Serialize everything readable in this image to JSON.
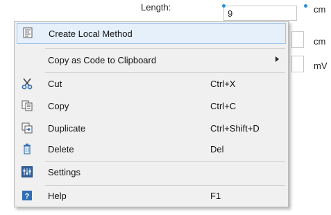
{
  "form": {
    "length_label": "Length:",
    "length_value": "9",
    "units": [
      "cm",
      "cm",
      "mV"
    ]
  },
  "menu": {
    "create_local_method": "Create Local Method",
    "copy_as_code": "Copy as Code to Clipboard",
    "cut": "Cut",
    "cut_shortcut": "Ctrl+X",
    "copy": "Copy",
    "copy_shortcut": "Ctrl+C",
    "duplicate": "Duplicate",
    "duplicate_shortcut": "Ctrl+Shift+D",
    "delete": "Delete",
    "delete_shortcut": "Del",
    "settings": "Settings",
    "help": "Help",
    "help_shortcut": "F1"
  },
  "colors": {
    "highlight_bg": "#e5f0fb",
    "highlight_border": "#9fc4ea",
    "handle": "#2b8fd8",
    "help_icon": "#2f6fb6"
  }
}
